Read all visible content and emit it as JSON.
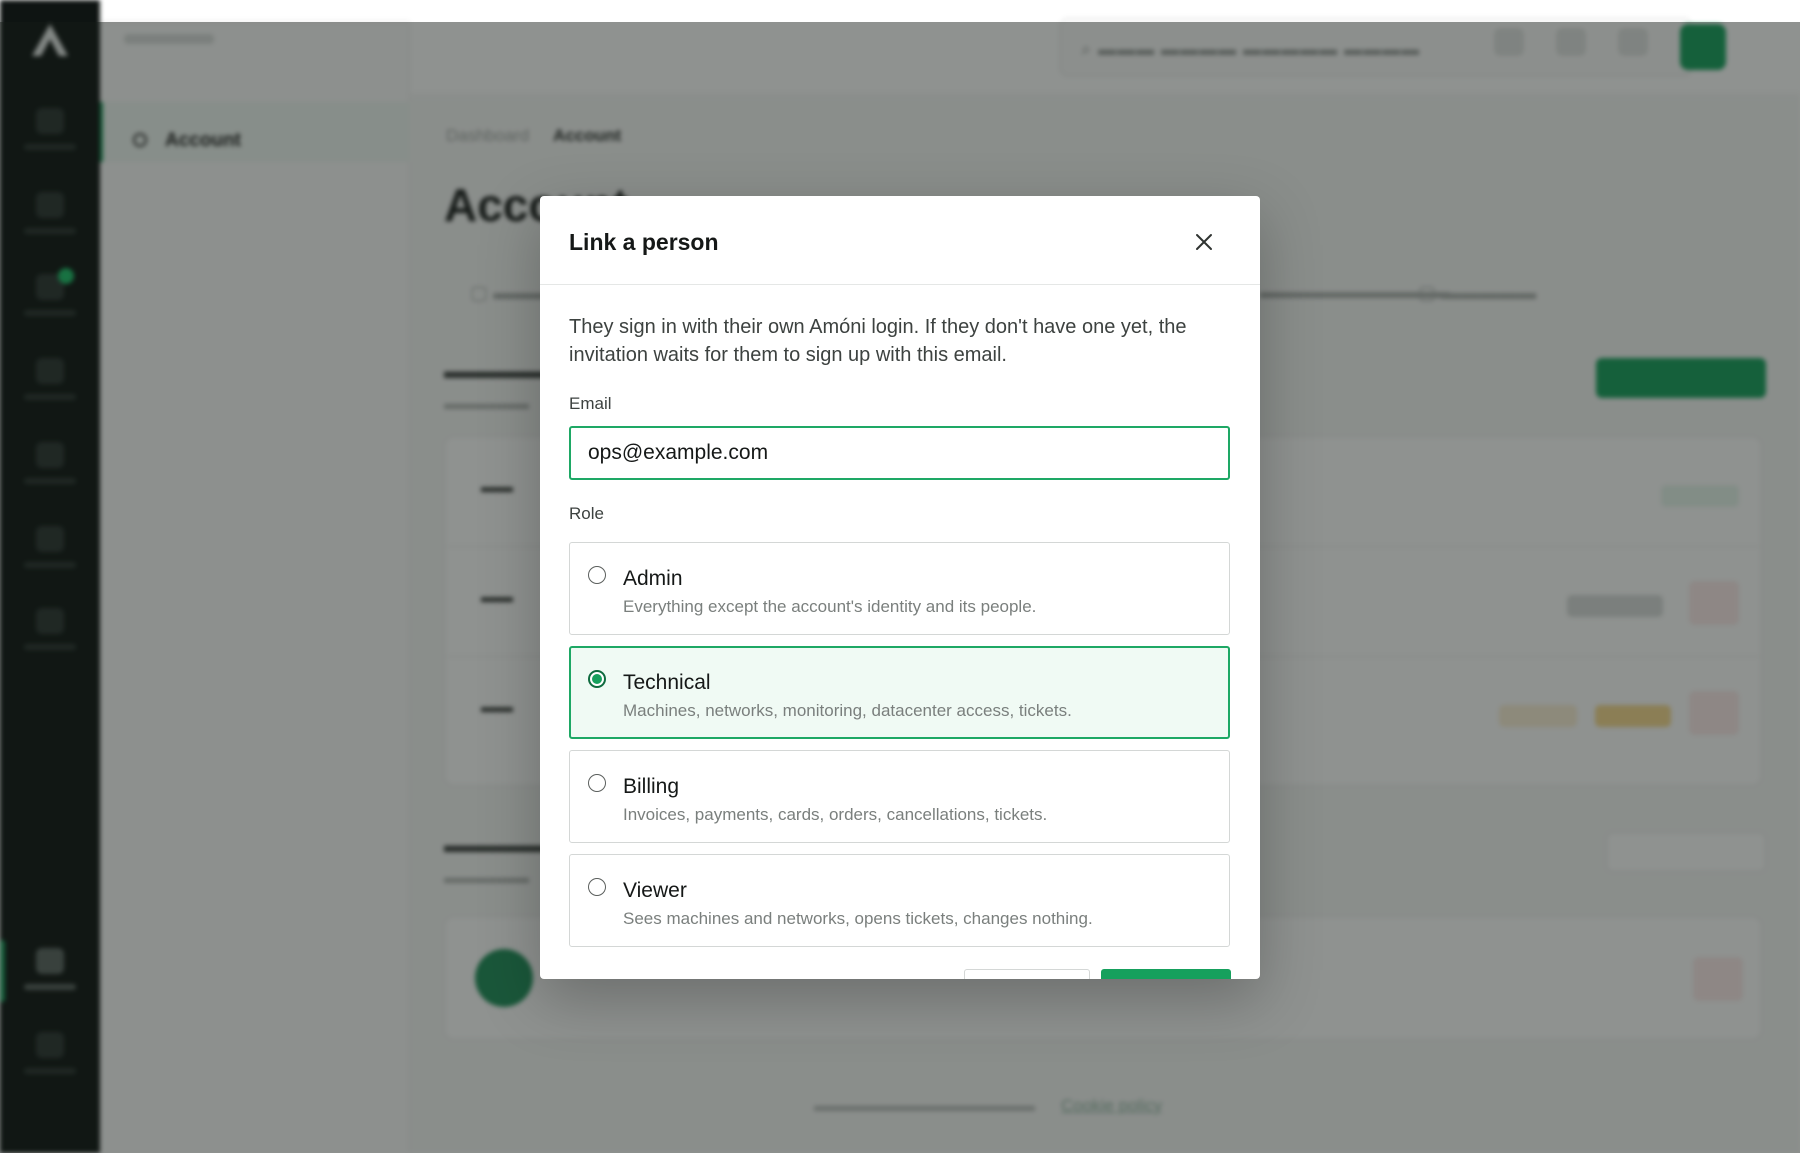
{
  "background": {
    "sidebar_item": "Account",
    "breadcrumb": {
      "parent": "Dashboard",
      "current": "Account"
    },
    "page_title": "Account",
    "footer_link": "Cookie policy"
  },
  "modal": {
    "title": "Link a person",
    "intro": "They sign in with their own Amóni login. If they don't have one yet, the invitation waits for them to sign up with this email.",
    "email_label": "Email",
    "email_value": "ops@example.com",
    "role_label": "Role",
    "selected_role": "technical",
    "roles": [
      {
        "key": "admin",
        "title": "Admin",
        "description": "Everything except the account's identity and its people."
      },
      {
        "key": "technical",
        "title": "Technical",
        "description": "Machines, networks, monitoring, datacenter access, tickets."
      },
      {
        "key": "billing",
        "title": "Billing",
        "description": "Invoices, payments, cards, orders, cancellations, tickets."
      },
      {
        "key": "viewer",
        "title": "Viewer",
        "description": "Sees machines and networks, opens tickets, changes nothing."
      }
    ]
  },
  "icons": {
    "close": "close-icon",
    "logo": "brand-logo-icon"
  },
  "colors": {
    "accent": "#16a05d",
    "rail": "#0e1412",
    "overlay": "rgba(20,28,24,0.48)"
  }
}
